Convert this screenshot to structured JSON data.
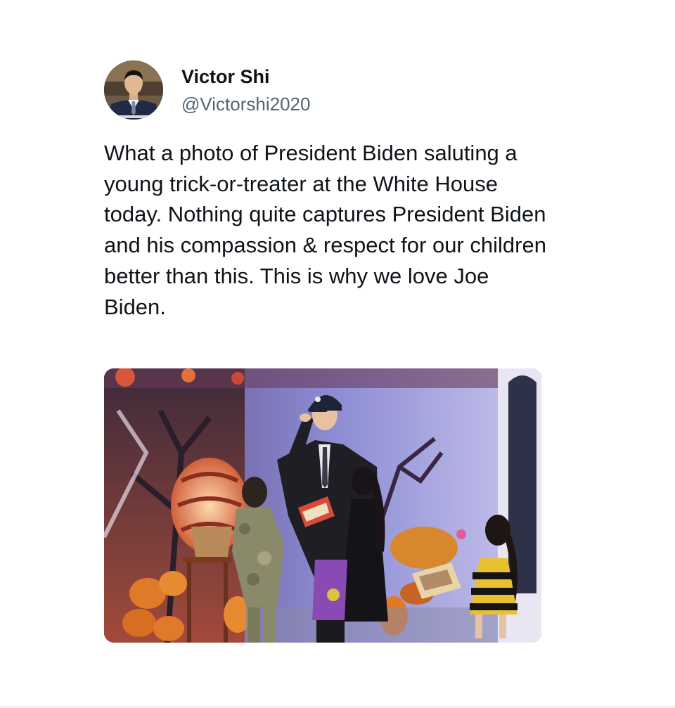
{
  "author": {
    "display_name": "Victor Shi",
    "handle": "@Victorshi2020",
    "avatar_icon": "profile-photo"
  },
  "tweet": {
    "text": "What a photo of President Biden saluting a young trick-or-treater at the White House today. Nothing quite captures President Biden and his compassion & respect for our children better than this. This is why we love Joe Biden."
  },
  "colors": {
    "text_primary": "#0f1419",
    "text_secondary": "#536471",
    "background": "#ffffff"
  }
}
